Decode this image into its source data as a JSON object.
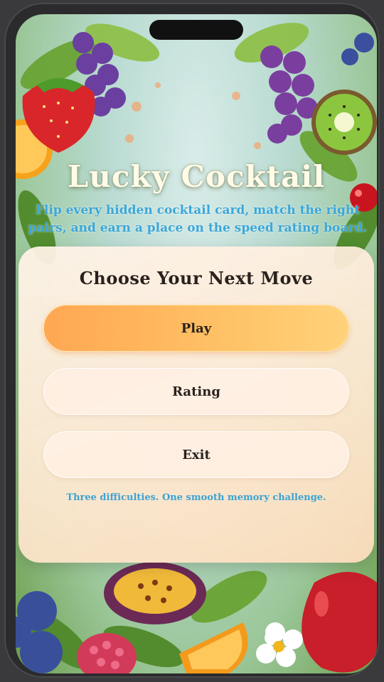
{
  "app": {
    "title": "Lucky Cocktail",
    "subtitle": "Flip every hidden cocktail card, match the right pairs, and earn a place on the speed rating board."
  },
  "menu": {
    "heading": "Choose Your Next Move",
    "play_label": "Play",
    "rating_label": "Rating",
    "exit_label": "Exit",
    "footer_text": "Three difficulties. One smooth memory challenge."
  },
  "colors": {
    "accent": "#ffa752",
    "subtitle_text": "#3ba7d9"
  },
  "icons": [
    "strawberry-icon",
    "grapes-icon",
    "kiwi-icon",
    "orange-slice-icon",
    "cherry-icon",
    "blueberry-icon",
    "raspberry-icon",
    "passion-fruit-icon",
    "apple-icon",
    "flower-icon"
  ]
}
